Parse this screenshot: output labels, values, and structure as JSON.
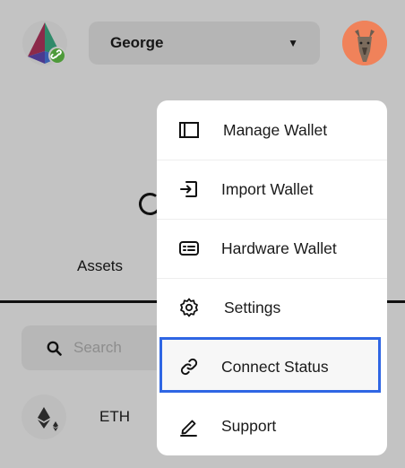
{
  "header": {
    "account_name": "George",
    "account_caret": "▼",
    "logo_icon": "prism-logo-icon",
    "connected_badge_icon": "link-icon",
    "avatar_icon": "rhino-avatar"
  },
  "page": {
    "assets_tab_label": "Assets",
    "search_placeholder": "Search",
    "token_symbol": "ETH"
  },
  "menu": {
    "items": [
      {
        "label": "Manage Wallet",
        "icon": "sidebar-panel-icon"
      },
      {
        "label": "Import Wallet",
        "icon": "import-icon"
      },
      {
        "label": "Hardware Wallet",
        "icon": "hardware-wallet-icon"
      },
      {
        "label": "Settings",
        "icon": "gear-icon"
      },
      {
        "label": "Connect Status",
        "icon": "link-icon",
        "highlighted": true
      },
      {
        "label": "Support",
        "icon": "pencil-icon"
      }
    ]
  },
  "colors": {
    "highlight_border": "#2f66e4",
    "avatar_bg": "#f0825a",
    "badge_green": "#4e9a3a"
  }
}
